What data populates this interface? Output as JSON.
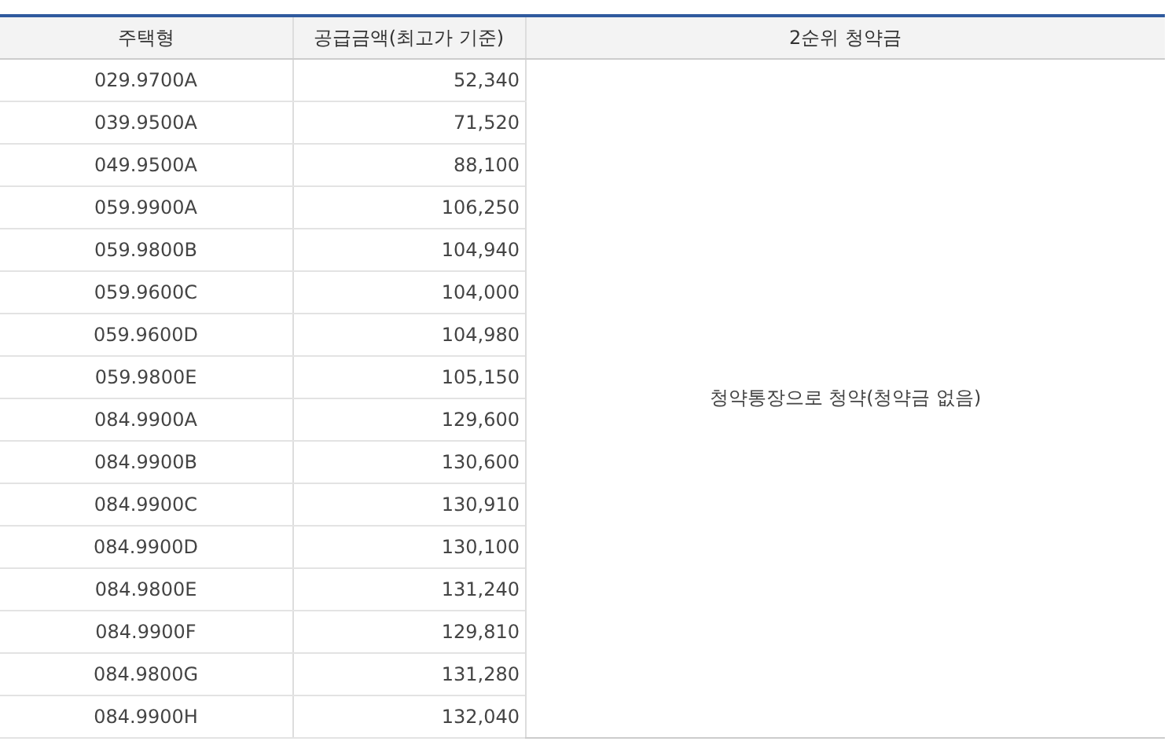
{
  "table": {
    "columns": [
      "주택형",
      "공급금액(최고가 기준)",
      "2순위 청약금"
    ],
    "rows": [
      {
        "type": "029.9700A",
        "amount": "52,340"
      },
      {
        "type": "039.9500A",
        "amount": "71,520"
      },
      {
        "type": "049.9500A",
        "amount": "88,100"
      },
      {
        "type": "059.9900A",
        "amount": "106,250"
      },
      {
        "type": "059.9800B",
        "amount": "104,940"
      },
      {
        "type": "059.9600C",
        "amount": "104,000"
      },
      {
        "type": "059.9600D",
        "amount": "104,980"
      },
      {
        "type": "059.9800E",
        "amount": "105,150"
      },
      {
        "type": "084.9900A",
        "amount": "129,600"
      },
      {
        "type": "084.9900B",
        "amount": "130,600"
      },
      {
        "type": "084.9900C",
        "amount": "130,910"
      },
      {
        "type": "084.9900D",
        "amount": "130,100"
      },
      {
        "type": "084.9800E",
        "amount": "131,240"
      },
      {
        "type": "084.9900F",
        "amount": "129,810"
      },
      {
        "type": "084.9800G",
        "amount": "131,280"
      },
      {
        "type": "084.9900H",
        "amount": "132,040"
      }
    ],
    "merged_note": "청약통장으로 청약(청약금 없음)"
  }
}
